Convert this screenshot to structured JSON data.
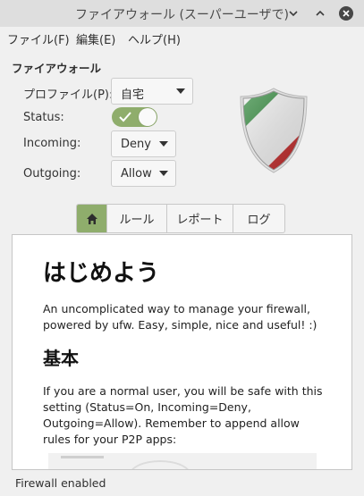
{
  "window": {
    "title": "ファイアウォール (スーパーユーザで)"
  },
  "menu": {
    "file": "ファイル(F)",
    "edit": "編集(E)",
    "help": "ヘルプ(H)"
  },
  "firewall": {
    "section_title": "ファイアウォール",
    "profile_label": "プロファイル(P):",
    "profile_value": "自宅",
    "status_label": "Status:",
    "status_on": true,
    "incoming_label": "Incoming:",
    "incoming_value": "Deny",
    "outgoing_label": "Outgoing:",
    "outgoing_value": "Allow"
  },
  "tabs": {
    "home_icon": "home-icon",
    "rules": "ルール",
    "report": "レポート",
    "log": "ログ"
  },
  "content": {
    "heading": "はじめよう",
    "intro": "An uncomplicated way to manage your firewall, powered by ufw. Easy, simple, nice and useful! :)",
    "subheading": "基本",
    "basic_text": "If you are a normal user, you will be safe with this setting (Status=On, Incoming=Deny, Outgoing=Allow). Remember to append allow rules for your P2P apps:"
  },
  "statusbar": {
    "text": "Firewall enabled"
  },
  "colors": {
    "accent": "#8fad6c",
    "shield_green": "#2f8a3a",
    "shield_red": "#c62a2a"
  }
}
